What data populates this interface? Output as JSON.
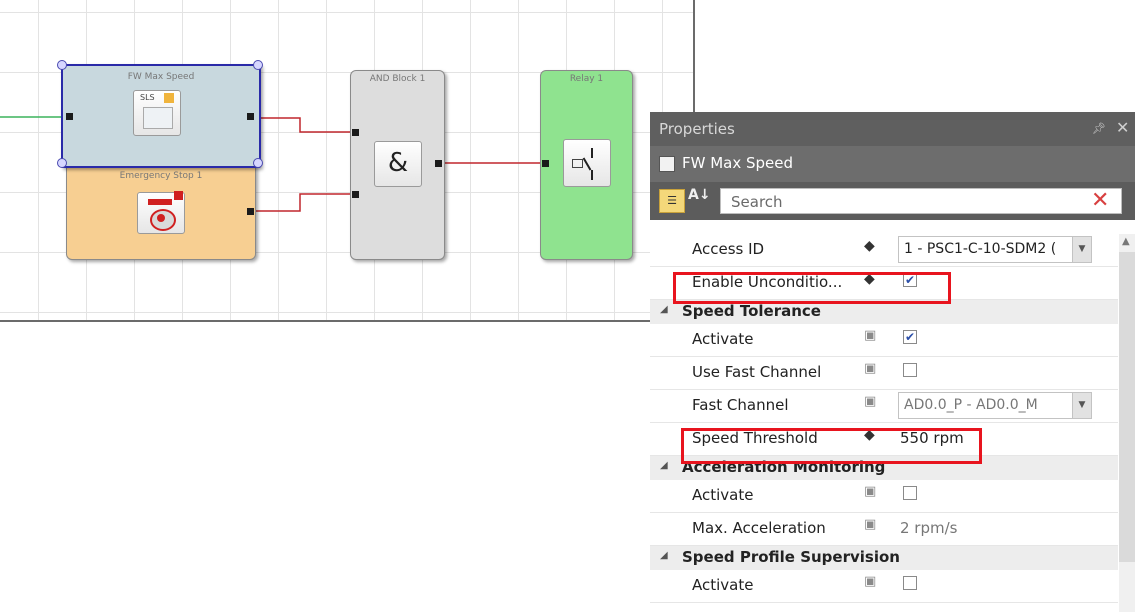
{
  "canvas": {
    "blocks": {
      "fw_max_speed": {
        "title": "FW Max Speed",
        "icon_label": "SLS"
      },
      "emergency_stop": {
        "title": "Emergency Stop 1"
      },
      "and_block": {
        "title": "AND Block 1",
        "symbol": "&"
      },
      "relay": {
        "title": "Relay 1"
      }
    },
    "colors": {
      "wire": "#c0272d",
      "input_wire": "#3bb45c",
      "selection": "#2a2aa8"
    }
  },
  "properties": {
    "panel_title": "Properties",
    "pin_icon": "pin-icon",
    "close_icon": "close-icon",
    "object_name": "FW Max Speed",
    "search_placeholder": "Search",
    "rows": {
      "access_id": {
        "label": "Access ID",
        "value": "1 - PSC1-C-10-SDM2 ("
      },
      "enable_unconditional": {
        "label": "Enable Unconditio...",
        "checked": true
      },
      "speed_tolerance": {
        "header": "Speed Tolerance",
        "activate": {
          "label": "Activate",
          "checked": true
        },
        "use_fast_channel": {
          "label": "Use Fast Channel",
          "checked": false
        },
        "fast_channel": {
          "label": "Fast Channel",
          "value": "AD0.0_P - AD0.0_M"
        },
        "speed_threshold": {
          "label": "Speed Threshold",
          "value": "550 rpm"
        }
      },
      "acceleration_monitoring": {
        "header": "Acceleration Monitoring",
        "activate": {
          "label": "Activate",
          "checked": false
        },
        "max_acceleration": {
          "label": "Max. Acceleration",
          "value": "2 rpm/s"
        }
      },
      "speed_profile_supervision": {
        "header": "Speed Profile Supervision",
        "activate": {
          "label": "Activate",
          "checked": false
        }
      }
    },
    "highlight_color": "#e8141e"
  }
}
